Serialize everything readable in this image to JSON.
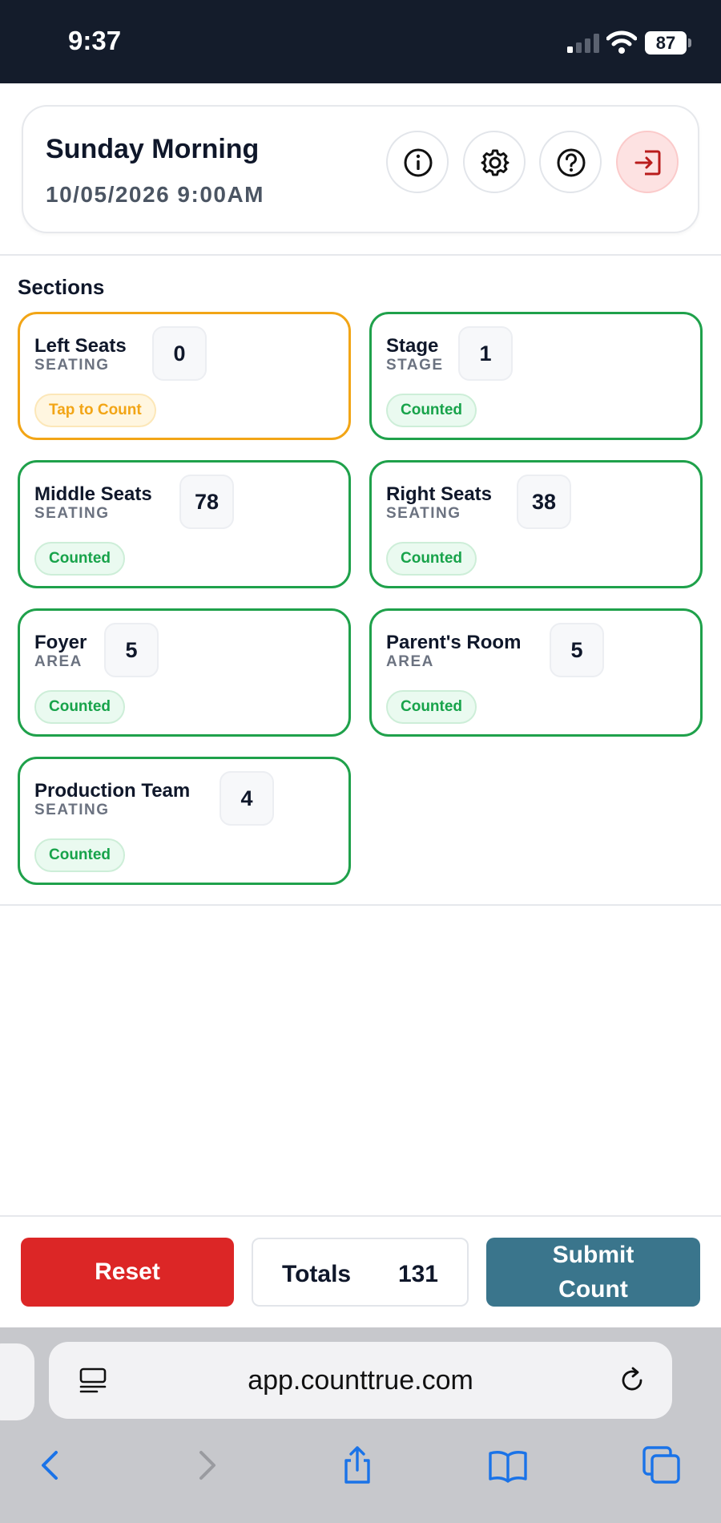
{
  "status_bar": {
    "time": "9:37",
    "battery": "87"
  },
  "header": {
    "title": "Sunday Morning",
    "datetime": "10/05/2026 9:00AM",
    "buttons": [
      "info-icon",
      "gear-icon",
      "help-icon",
      "exit-icon"
    ]
  },
  "sections": {
    "heading": "Sections",
    "items": [
      {
        "name": "Left Seats",
        "type": "SEATING",
        "count": "0",
        "status": "Tap to Count",
        "state": "pending"
      },
      {
        "name": "Stage",
        "type": "STAGE",
        "count": "1",
        "status": "Counted",
        "state": "counted"
      },
      {
        "name": "Middle Seats",
        "type": "SEATING",
        "count": "78",
        "status": "Counted",
        "state": "counted"
      },
      {
        "name": "Right Seats",
        "type": "SEATING",
        "count": "38",
        "status": "Counted",
        "state": "counted"
      },
      {
        "name": "Foyer",
        "type": "AREA",
        "count": "5",
        "status": "Counted",
        "state": "counted"
      },
      {
        "name": "Parent's Room",
        "type": "AREA",
        "count": "5",
        "status": "Counted",
        "state": "counted"
      },
      {
        "name": "Production Team",
        "type": "SEATING",
        "count": "4",
        "status": "Counted",
        "state": "counted"
      }
    ]
  },
  "actions": {
    "reset_label": "Reset",
    "totals_label": "Totals",
    "totals_value": "131",
    "submit_line1": "Submit",
    "submit_line2": "Count"
  },
  "browser": {
    "url": "app.counttrue.com"
  },
  "colors": {
    "status_bar_bg": "#141c2b",
    "counted_border": "#1fa14b",
    "pending_border": "#f2a516",
    "reset_bg": "#dc2626",
    "submit_bg": "#3a758c",
    "exit_bg": "#fde2e2",
    "browser_chrome_bg": "#c7c8cc",
    "link_blue": "#1a73e8"
  }
}
